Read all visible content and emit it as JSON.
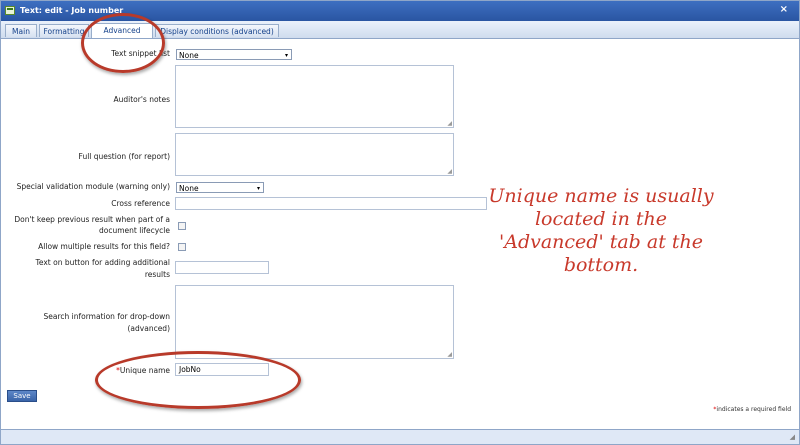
{
  "window": {
    "title": "Text: edit - Job number",
    "close_glyph": "×"
  },
  "tabs": [
    {
      "label": "Main",
      "active": false
    },
    {
      "label": "Formatting",
      "active": false
    },
    {
      "label": "Advanced",
      "active": true
    },
    {
      "label": "Display conditions (advanced)",
      "active": false
    }
  ],
  "form": {
    "text_snippet_list": {
      "label": "Text snippet list",
      "value": "None"
    },
    "auditors_notes": {
      "label": "Auditor's notes"
    },
    "full_question": {
      "label": "Full question (for report)"
    },
    "special_validation": {
      "label": "Special validation module (warning only)",
      "value": "None"
    },
    "cross_reference": {
      "label": "Cross reference",
      "value": ""
    },
    "dont_keep_previous": {
      "label_line1": "Don't keep previous result when part of a",
      "label_line2": "document lifecycle",
      "checked": false
    },
    "allow_multiple": {
      "label": "Allow multiple results for this field?",
      "checked": false
    },
    "text_on_button": {
      "label_line1": "Text on button for adding additional",
      "label_line2": "results",
      "value": ""
    },
    "search_info": {
      "label_line1": "Search information for drop-down",
      "label_line2": "(advanced)"
    },
    "unique_name": {
      "required_mark": "*",
      "label": "Unique name",
      "value": "JobNo"
    }
  },
  "save_label": "Save",
  "required_note": {
    "mark": "*",
    "text": "indicates a required field"
  },
  "annotation": {
    "line1": "Unique name is usually",
    "line2": "located in the",
    "line3": "'Advanced' tab at the",
    "line4": "bottom."
  },
  "colors": {
    "accent": "#2a55a2",
    "annotation": "#c8392b",
    "required": "#dd0000"
  },
  "icons": {
    "select_arrow": "▾",
    "resize_grip": "◢"
  }
}
